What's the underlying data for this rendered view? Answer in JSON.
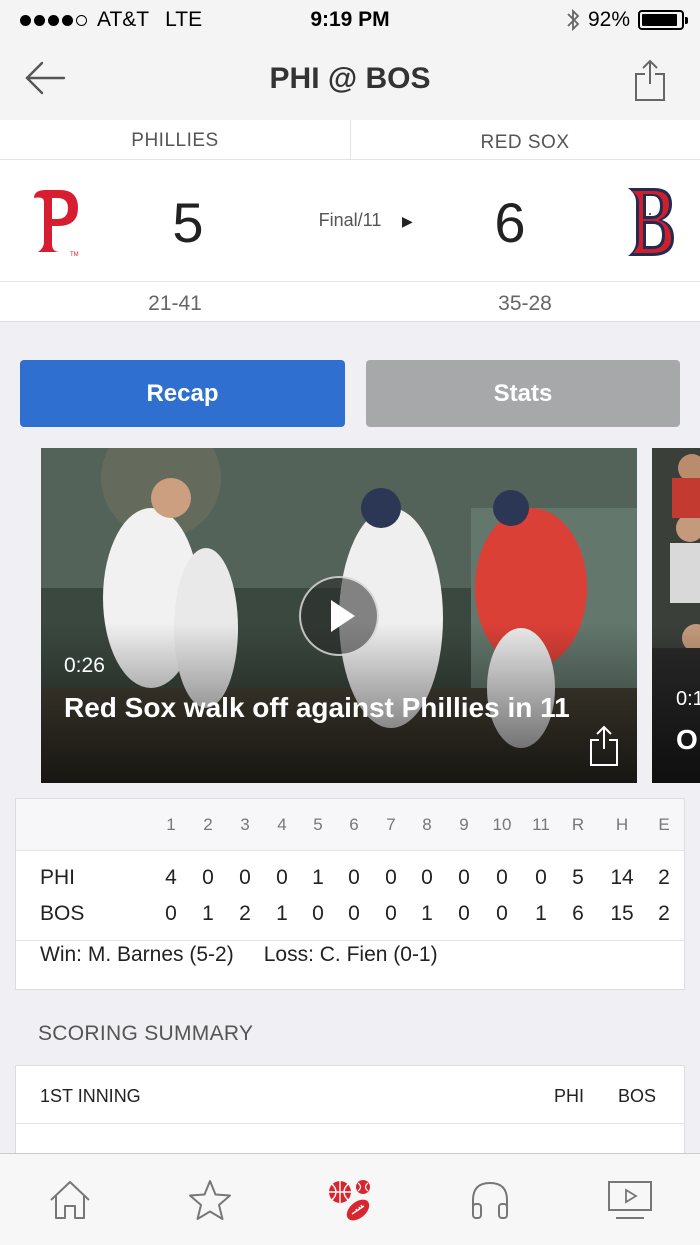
{
  "status_bar": {
    "carrier": "AT&T",
    "network": "LTE",
    "time": "9:19 PM",
    "battery": "92%",
    "battery_level": 0.92,
    "signal_dots_filled": 4,
    "signal_dots_total": 5
  },
  "nav": {
    "title": "PHI @ BOS",
    "back_icon": "back-arrow-icon",
    "share_icon": "share-icon"
  },
  "game": {
    "away": {
      "name": "PHILLIES",
      "score": "5",
      "record": "21-41",
      "logo": "phillies-logo",
      "color": "#e81828"
    },
    "home": {
      "name": "RED SOX",
      "score": "6",
      "record": "35-28",
      "logo": "red-sox-logo",
      "color": "#bd3039"
    },
    "status": "Final/11",
    "status_icon": "play-arrow-icon"
  },
  "buttons": {
    "recap": "Recap",
    "stats": "Stats",
    "recap_color": "#2f6fd0",
    "stats_color": "#a7a8aa"
  },
  "videos": [
    {
      "duration": "0:26",
      "title": "Red Sox walk off against Phillies in 11"
    },
    {
      "duration": "0:1",
      "title": "O"
    }
  ],
  "linescore": {
    "headers": [
      "1",
      "2",
      "3",
      "4",
      "5",
      "6",
      "7",
      "8",
      "9",
      "10",
      "11",
      "R",
      "H",
      "E"
    ],
    "rows": [
      {
        "team": "PHI",
        "values": [
          "4",
          "0",
          "0",
          "0",
          "1",
          "0",
          "0",
          "0",
          "0",
          "0",
          "0",
          "5",
          "14",
          "2"
        ]
      },
      {
        "team": "BOS",
        "values": [
          "0",
          "1",
          "2",
          "1",
          "0",
          "0",
          "0",
          "1",
          "0",
          "0",
          "1",
          "6",
          "15",
          "2"
        ]
      }
    ],
    "win": "Win: M. Barnes (5-2)",
    "loss": "Loss: C. Fien (0-1)"
  },
  "scoring_summary": {
    "label": "SCORING SUMMARY",
    "inning": "1ST INNING",
    "away": "PHI",
    "home": "BOS"
  },
  "tab_bar": [
    {
      "icon": "home-icon",
      "active": false
    },
    {
      "icon": "star-icon",
      "active": false
    },
    {
      "icon": "sports-icon",
      "active": true
    },
    {
      "icon": "headphones-icon",
      "active": false
    },
    {
      "icon": "video-icon",
      "active": false
    }
  ]
}
